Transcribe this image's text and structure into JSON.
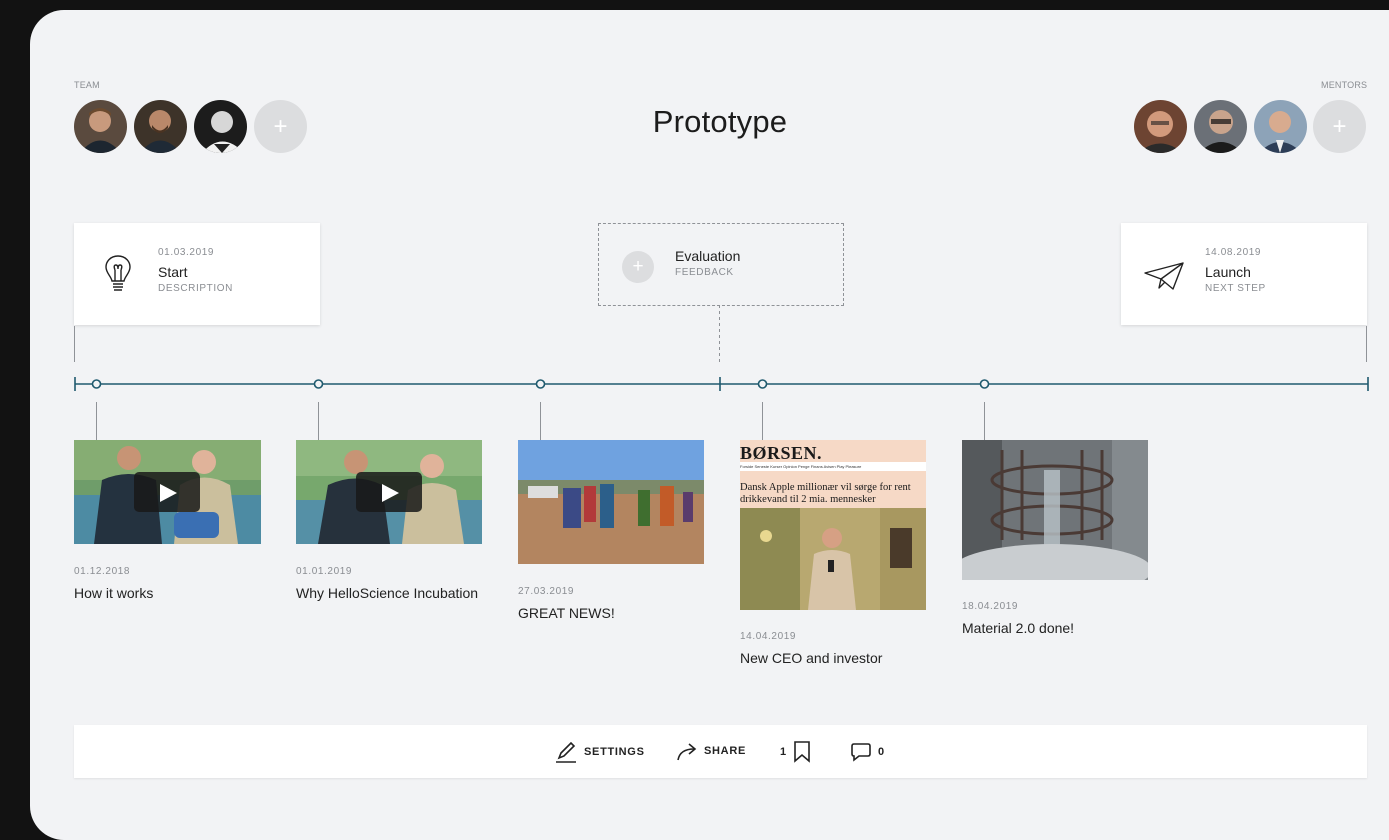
{
  "header": {
    "team_label": "TEAM",
    "mentors_label": "MENTORS",
    "title": "Prototype",
    "add_symbol": "+"
  },
  "team": [
    {
      "name": "team-member-1",
      "color": "#4a3b2f"
    },
    {
      "name": "team-member-2",
      "color": "#3a2e26"
    },
    {
      "name": "team-member-3",
      "color": "#2d2d2d"
    }
  ],
  "mentors": [
    {
      "name": "mentor-1",
      "color": "#7a4a34"
    },
    {
      "name": "mentor-2",
      "color": "#5a5f66"
    },
    {
      "name": "mentor-3",
      "color": "#4b5d78"
    }
  ],
  "milestones": {
    "start": {
      "date": "01.03.2019",
      "title": "Start",
      "subtitle": "DESCRIPTION",
      "icon": "lightbulb-icon"
    },
    "evaluation": {
      "title": "Evaluation",
      "subtitle": "FEEDBACK",
      "icon": "plus-icon"
    },
    "launch": {
      "date": "14.08.2019",
      "title": "Launch",
      "subtitle": "NEXT STEP",
      "icon": "paper-plane-icon"
    }
  },
  "timeline": {
    "color": "#1f5a6e"
  },
  "posts": [
    {
      "date": "01.12.2018",
      "title": "How it works",
      "type": "video"
    },
    {
      "date": "01.01.2019",
      "title": "Why HelloScience Incubation",
      "type": "video"
    },
    {
      "date": "27.03.2019",
      "title": "GREAT NEWS!",
      "type": "image"
    },
    {
      "date": "14.04.2019",
      "title": "New CEO and investor",
      "type": "article",
      "article": {
        "masthead": "BØRSEN.",
        "nav": "Forside  Seneste  Kurser  Opinion  Penge  Finans  Avisen  Play  Pleasure",
        "headline": "Dansk Apple millionær vil sørge for rent drikkevand til 2 mia. mennesker"
      }
    },
    {
      "date": "18.04.2019",
      "title": "Material 2.0 done!",
      "type": "image"
    }
  ],
  "footer": {
    "settings_label": "SETTINGS",
    "share_label": "SHARE",
    "bookmark_count": "1",
    "comment_count": "0"
  }
}
